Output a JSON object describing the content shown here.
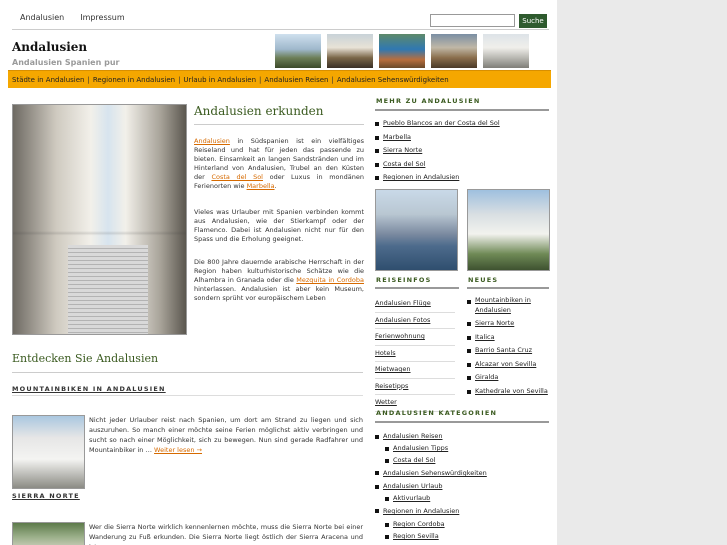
{
  "topnav": [
    "Andalusien",
    "Impressum"
  ],
  "search": {
    "placeholder": "",
    "button_label": "Suche"
  },
  "site": {
    "title": "Andalusien",
    "subtitle": "Andalusien Spanien pur"
  },
  "menubar": [
    "Städte in Andalusien",
    "Regionen in Andalusien",
    "Urlaub in Andalusien",
    "Andalusien Reisen",
    "Andalusien Sehenswürdigkeiten"
  ],
  "main": {
    "title": "Andalusien erkunden",
    "p1": {
      "link1": "Andalusien",
      "t1": " in Südspanien ist ein vielfältiges Reiseland und hat für jeden das passende zu bieten. Einsamkeit an langen Sandstränden und im Hinterland von Andalusien, Trubel an den Küsten der ",
      "link2": "Costa del Sol",
      "t2": " oder Luxus in mondänen Ferienorten wie ",
      "link3": "Marbella",
      "t3": "."
    },
    "p2": "Vieles was Urlauber mit Spanien verbinden kommt aus Andalusien, wie der Stierkampf oder der Flamenco. Dabei ist Andalusien nicht nur für den Spass und die Erholung geeignet.",
    "p3": {
      "t1": "Die 800 Jahre dauernde arabische Herrschaft in der Region haben kulturhistorische Schätze wie die Alhambra in Granada oder die ",
      "link": "Mezquita in Cordoba",
      "t2": " hinterlassen. Andalusien ist aber kein Museum, sondern sprüht vor europäischem Leben"
    },
    "h2": "Entdecken Sie Andalusien",
    "section1": "MOUNTAINBIKEN IN ANDALUSIEN",
    "section1_text": "Nicht jeder Urlauber reist nach Spanien, um dort am Strand zu liegen und sich auszuruhen. So manch einer möchte seine Ferien möglichst aktiv verbringen und sucht so nach einer Möglichkeit, sich zu bewegen. Nun sind gerade Radfahrer und Mountainbiker in … ",
    "section1_more": "Weiter lesen →",
    "section2": "SIERRA NORTE",
    "section2_text": "Wer die  Sierra Norte wirklich kennenlernen möchte, muss die Sierra Norte bei einer Wanderung zu Fuß erkunden. Die Sierra Norte liegt östlich der Sierra Aracena und ist"
  },
  "sidebar": {
    "mehr_title": "MEHR ZU ANDALUSIEN",
    "mehr": [
      "Pueblo Blancos an der Costa del Sol",
      "Marbella",
      "Sierra Norte",
      "Costa del Sol",
      "Regionen in Andalusien"
    ],
    "reiseinfos_title": "REISEINFOS",
    "reiseinfos": [
      "Andalusien Flüge",
      "Andalusien Fotos",
      "Ferienwohnung",
      "Hotels",
      "Mietwagen",
      "Reisetipps",
      "Wetter"
    ],
    "news_title": "NEUES",
    "news": [
      "Mountainbiken in Andalusien",
      "Sierra Norte",
      "Italica",
      "Barrio Santa Cruz",
      "Alcazar von Sevilla",
      "Giralda",
      "Kathedrale von Sevilla"
    ],
    "kat_title": "ANDALUSIEN KATEGORIEN",
    "kat": [
      {
        "label": "Andalusien Reisen",
        "sub": false
      },
      {
        "label": "Andalusien Tipps",
        "sub": true
      },
      {
        "label": "Costa del Sol",
        "sub": true
      },
      {
        "label": "Andalusien Sehenswürdigkeiten",
        "sub": false
      },
      {
        "label": "Andalusien Urlaub",
        "sub": false
      },
      {
        "label": "Aktivurlaub",
        "sub": true
      },
      {
        "label": "Regionen in Andalusien",
        "sub": false
      },
      {
        "label": "Region Cordoba",
        "sub": true
      },
      {
        "label": "Region Sevilla",
        "sub": true
      }
    ]
  }
}
